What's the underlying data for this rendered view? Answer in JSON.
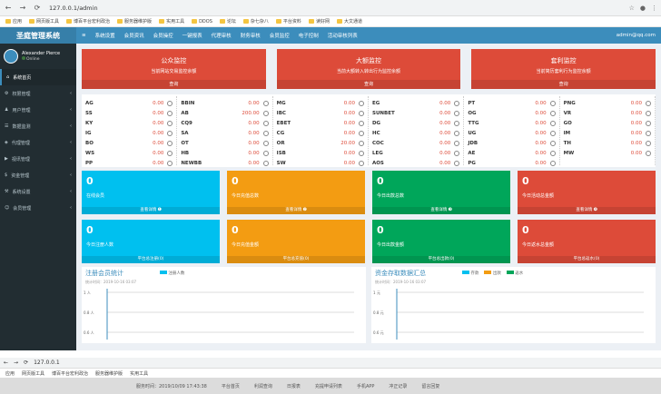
{
  "browser": {
    "url": "127.0.0.1/admin",
    "url2": "127.0.0.1",
    "bookmarks": [
      "应用",
      "网页版工具",
      "博百平台宏利政治",
      "服务器维护版",
      "实用工具",
      "DDOS",
      "论坛",
      "杂七杂八",
      "平台资料",
      "读好网",
      "大文通道"
    ]
  },
  "app": {
    "logo": "圣庭管理系统",
    "user": {
      "name": "Alexander Pierce",
      "status": "Online"
    },
    "menu": [
      "系统首页",
      "权限管理",
      "用户管理",
      "数据监测",
      "代理管理",
      "视讯管理",
      "资金管理",
      "系统设置",
      "会员管理"
    ],
    "nav": [
      "系统设置",
      "会员资讯",
      "会员操控",
      "一键报表",
      "代理审核",
      "财务审核",
      "会员监控",
      "电子控制",
      "活动审核列表"
    ],
    "email": "admin@qq.com"
  },
  "panels": [
    {
      "title": "公众监控",
      "desc": "当前网站交易监控余额",
      "btn": "查询"
    },
    {
      "title": "大额监控",
      "desc": "当前大额转入转出行为监控余额",
      "btn": "查询"
    },
    {
      "title": "套利监控",
      "desc": "当前简历套利行为监控余额",
      "btn": "查询"
    }
  ],
  "balances": [
    [
      [
        "AG",
        "0.00"
      ],
      [
        "SS",
        "0.00"
      ],
      [
        "KY",
        "0.00"
      ],
      [
        "IG",
        "0.00"
      ],
      [
        "BO",
        "0.00"
      ],
      [
        "WS",
        "0.00"
      ],
      [
        "PP",
        "0.00"
      ]
    ],
    [
      [
        "BBIN",
        "0.00"
      ],
      [
        "AB",
        "200.00"
      ],
      [
        "CQ9",
        "0.00"
      ],
      [
        "SA",
        "0.00"
      ],
      [
        "OT",
        "0.00"
      ],
      [
        "HB",
        "0.00"
      ],
      [
        "NEWBB",
        "0.00"
      ]
    ],
    [
      [
        "MG",
        "0.00"
      ],
      [
        "IBC",
        "0.00"
      ],
      [
        "EBET",
        "0.00"
      ],
      [
        "CG",
        "0.00"
      ],
      [
        "OR",
        "20.00"
      ],
      [
        "ISB",
        "0.00"
      ],
      [
        "SW",
        "0.00"
      ]
    ],
    [
      [
        "EG",
        "0.00"
      ],
      [
        "SUNBET",
        "0.00"
      ],
      [
        "DG",
        "0.00"
      ],
      [
        "HC",
        "0.00"
      ],
      [
        "COC",
        "0.00"
      ],
      [
        "LEG",
        "0.00"
      ],
      [
        "AOS",
        "0.00"
      ]
    ],
    [
      [
        "PT",
        "0.00"
      ],
      [
        "OG",
        "0.00"
      ],
      [
        "TTG",
        "0.00"
      ],
      [
        "UG",
        "0.00"
      ],
      [
        "JDB",
        "0.00"
      ],
      [
        "AE",
        "0.00"
      ],
      [
        "PG",
        "0.00"
      ]
    ],
    [
      [
        "PNG",
        "0.00"
      ],
      [
        "VR",
        "0.00"
      ],
      [
        "GO",
        "0.00"
      ],
      [
        "IM",
        "0.00"
      ],
      [
        "TH",
        "0.00"
      ],
      [
        "MW",
        "0.00"
      ]
    ]
  ],
  "boxes": [
    {
      "n": "0",
      "l": "在线会员",
      "f": "查看详情 ➊",
      "c": "#00c0ef"
    },
    {
      "n": "0",
      "l": "今日充值总数",
      "f": "查看详情 ➋",
      "c": "#f39c12"
    },
    {
      "n": "0",
      "l": "今日出款总数",
      "f": "查看详情 ➌",
      "c": "#00a65a"
    },
    {
      "n": "0",
      "l": "今日活动总金额",
      "f": "查看详情 ➍",
      "c": "#dd4b39"
    },
    {
      "n": "0",
      "l": "今日注册人数",
      "f": "平台总注册(0)",
      "c": "#00c0ef"
    },
    {
      "n": "0",
      "l": "今日充值金额",
      "f": "平台总充值(0)",
      "c": "#f39c12"
    },
    {
      "n": "0",
      "l": "今日出款金额",
      "f": "平台总出款(0)",
      "c": "#00a65a"
    },
    {
      "n": "0",
      "l": "今日返水总金额",
      "f": "平台总返水(0)",
      "c": "#dd4b39"
    }
  ],
  "charts": [
    {
      "title": "注册会员统计",
      "sub": "统计时间：2019-10-16 03:07",
      "legend": [
        "注册人数"
      ],
      "ticks": [
        "1 人",
        "0.8 人",
        "0.6 人"
      ]
    },
    {
      "title": "资金存取数据汇总",
      "sub": "统计时间：2019-10-16 03:07",
      "legend": [
        "存款",
        "出款",
        "返水"
      ],
      "ticks": [
        "1 元",
        "0.8 元",
        "0.6 元"
      ]
    }
  ],
  "footer": [
    "平台首页",
    "利润查询",
    "日报表",
    "充提申请列表",
    "手机APP",
    "冲正记录",
    "留言回复"
  ],
  "time": "服务时间：2019/10/09 17:43:38"
}
